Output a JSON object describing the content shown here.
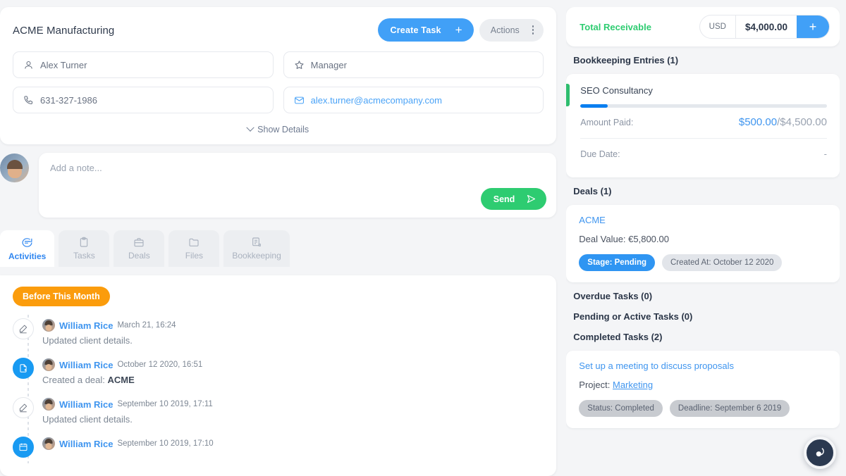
{
  "contact": {
    "company": "ACME Manufacturing",
    "create_task_label": "Create Task",
    "actions_label": "Actions",
    "person_name": "Alex Turner",
    "role": "Manager",
    "phone": "631-327-1986",
    "email": "alex.turner@acmecompany.com",
    "show_details_label": "Show Details"
  },
  "note": {
    "placeholder": "Add a note...",
    "send_label": "Send"
  },
  "tabs": [
    {
      "label": "Activities",
      "icon": "chat-icon",
      "active": true
    },
    {
      "label": "Tasks",
      "icon": "clipboard-icon",
      "active": false
    },
    {
      "label": "Deals",
      "icon": "briefcase-icon",
      "active": false
    },
    {
      "label": "Files",
      "icon": "folder-icon",
      "active": false
    },
    {
      "label": "Bookkeeping",
      "icon": "ledger-icon",
      "active": false
    }
  ],
  "activities": {
    "group_badge": "Before This Month",
    "items": [
      {
        "user": "William Rice",
        "time": "March 21, 16:24",
        "text": "Updated client details.",
        "icon": "pencil-icon",
        "highlight": ""
      },
      {
        "user": "William Rice",
        "time": "October 12 2020, 16:51",
        "text": "Created a deal:",
        "icon": "document-add-icon",
        "highlight": "ACME"
      },
      {
        "user": "William Rice",
        "time": "September 10 2019, 17:11",
        "text": "Updated client details.",
        "icon": "pencil-icon",
        "highlight": ""
      },
      {
        "user": "William Rice",
        "time": "September 10 2019, 17:10",
        "text": "",
        "icon": "calendar-icon",
        "highlight": ""
      }
    ]
  },
  "receivable": {
    "label": "Total Receivable",
    "currency": "USD",
    "amount": "$4,000.00",
    "add_label": "+"
  },
  "bookkeeping": {
    "section_title": "Bookkeeping Entries (1)",
    "entry_title": "SEO Consultancy",
    "progress_percent": 11,
    "amount_paid_label": "Amount Paid:",
    "amount_paid": "$500.00",
    "amount_separator": "/",
    "amount_total": "$4,500.00",
    "due_date_label": "Due Date:",
    "due_date_value": "-"
  },
  "deals": {
    "section_title": "Deals (1)",
    "name": "ACME",
    "value_label": "Deal Value: €5,800.00",
    "stage_pill": "Stage: Pending",
    "created_pill": "Created At: October 12 2020"
  },
  "tasks": {
    "overdue_title": "Overdue Tasks (0)",
    "pending_title": "Pending or Active Tasks (0)",
    "completed_title": "Completed Tasks (2)",
    "completed": {
      "title": "Set up a meeting to discuss proposals",
      "project_label": "Project:",
      "project_name": "Marketing",
      "status_pill": "Status: Completed",
      "deadline_pill": "Deadline: September 6 2019"
    }
  },
  "colors": {
    "primary_blue": "#41a0f7",
    "green": "#2ecc71",
    "orange": "#fb9c0c",
    "navy": "#2b3950"
  }
}
